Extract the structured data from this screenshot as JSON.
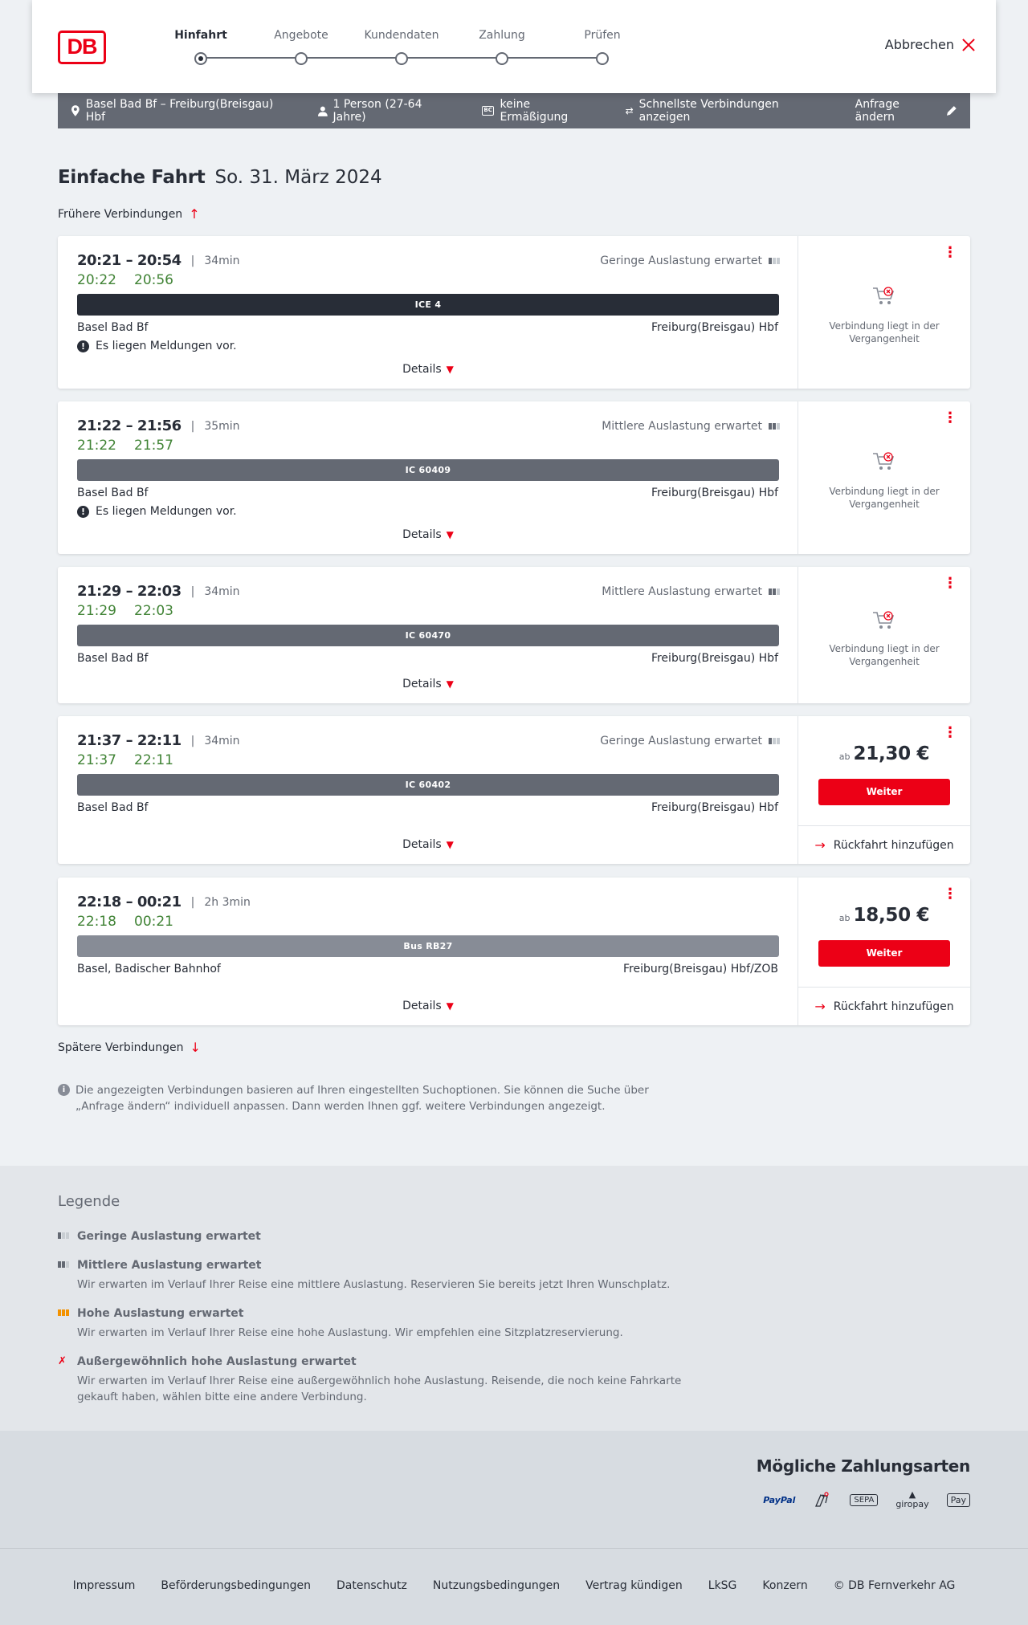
{
  "header": {
    "logo": "DB",
    "steps": [
      "Hinfahrt",
      "Angebote",
      "Kundendaten",
      "Zahlung",
      "Prüfen"
    ],
    "active_step": 0,
    "cancel_label": "Abbrechen"
  },
  "search": {
    "route": "Basel Bad Bf – Freiburg(Breisgau) Hbf",
    "passengers": "1 Person (27-64 Jahre)",
    "discount_badge": "BC",
    "discount": "keine Ermäßigung",
    "option": "Schnellste Verbindungen anzeigen",
    "edit_label": "Anfrage ändern"
  },
  "page": {
    "title": "Einfache Fahrt",
    "date": "So. 31. März 2024",
    "earlier": "Frühere Verbindungen",
    "later": "Spätere Verbindungen",
    "note": "Die angezeigten Verbindungen basieren auf Ihren eingestellten Suchoptionen. Sie können die Suche über „Anfrage ändern“ individuell anpassen. Dann werden Ihnen ggf. weitere Verbindungen angezeigt."
  },
  "connections": [
    {
      "times": "20:21 – 20:54",
      "duration": "34min",
      "rt_dep": "20:22",
      "rt_arr": "20:56",
      "load": "Geringe Auslastung erwartet",
      "load_level": 1,
      "train": "ICE 4",
      "train_color": "#282d37",
      "from": "Basel Bad Bf",
      "to": "Freiburg(Breisgau) Hbf",
      "message": "Es liegen Meldungen vor.",
      "details": "Details",
      "past": "Verbindung liegt in der Vergangenheit"
    },
    {
      "times": "21:22 – 21:56",
      "duration": "35min",
      "rt_dep": "21:22",
      "rt_arr": "21:57",
      "load": "Mittlere Auslastung erwartet",
      "load_level": 2,
      "train": "IC 60409",
      "train_color": "#646973",
      "from": "Basel Bad Bf",
      "to": "Freiburg(Breisgau) Hbf",
      "message": "Es liegen Meldungen vor.",
      "details": "Details",
      "past": "Verbindung liegt in der Vergangenheit"
    },
    {
      "times": "21:29 – 22:03",
      "duration": "34min",
      "rt_dep": "21:29",
      "rt_arr": "22:03",
      "load": "Mittlere Auslastung erwartet",
      "load_level": 2,
      "train": "IC 60470",
      "train_color": "#646973",
      "from": "Basel Bad Bf",
      "to": "Freiburg(Breisgau) Hbf",
      "details": "Details",
      "past": "Verbindung liegt in der Vergangenheit"
    },
    {
      "times": "21:37 – 22:11",
      "duration": "34min",
      "rt_dep": "21:37",
      "rt_arr": "22:11",
      "load": "Geringe Auslastung erwartet",
      "load_level": 1,
      "train": "IC 60402",
      "train_color": "#646973",
      "from": "Basel Bad Bf",
      "to": "Freiburg(Breisgau) Hbf",
      "details": "Details",
      "price_prefix": "ab",
      "price": "21,30 €",
      "button": "Weiter",
      "return": "Rückfahrt hinzufügen"
    },
    {
      "times": "22:18 – 00:21",
      "duration": "2h 3min",
      "rt_dep": "22:18",
      "rt_arr": "00:21",
      "load": "",
      "train": "Bus RB27",
      "train_color": "#878c96",
      "from": "Basel, Badischer Bahnhof",
      "to": "Freiburg(Breisgau) Hbf/ZOB",
      "details": "Details",
      "price_prefix": "ab",
      "price": "18,50 €",
      "button": "Weiter",
      "return": "Rückfahrt hinzufügen"
    }
  ],
  "legend": {
    "title": "Legende",
    "items": [
      {
        "title": "Geringe Auslastung erwartet",
        "text": "",
        "color": "#646973"
      },
      {
        "title": "Mittlere Auslastung erwartet",
        "text": "Wir erwarten im Verlauf Ihrer Reise eine mittlere Auslastung. Reservieren Sie bereits jetzt Ihren Wunschplatz.",
        "color": "#646973"
      },
      {
        "title": "Hohe Auslastung erwartet",
        "text": "Wir erwarten im Verlauf Ihrer Reise eine hohe Auslastung. Wir empfehlen eine Sitzplatzreservierung.",
        "color": "#f39200"
      },
      {
        "title": "Außergewöhnlich hohe Auslastung erwartet",
        "text": "Wir erwarten im Verlauf Ihrer Reise eine außergewöhnlich hohe Auslastung. Reisende, die noch keine Fahrkarte gekauft haben, wählen bitte eine andere Verbindung.",
        "color": "#ec0016"
      }
    ]
  },
  "payment": {
    "title": "Mögliche Zahlungsarten",
    "methods": [
      "PayPal",
      "SEPA",
      "giropay",
      "Pay"
    ]
  },
  "footer": {
    "links": [
      "Impressum",
      "Beförderungsbedingungen",
      "Datenschutz",
      "Nutzungsbedingungen",
      "Vertrag kündigen",
      "LkSG",
      "Konzern",
      "© DB Fernverkehr AG"
    ]
  },
  "colors": {
    "accent": "#ec0016",
    "realtime": "#408335",
    "dark": "#282d37"
  }
}
